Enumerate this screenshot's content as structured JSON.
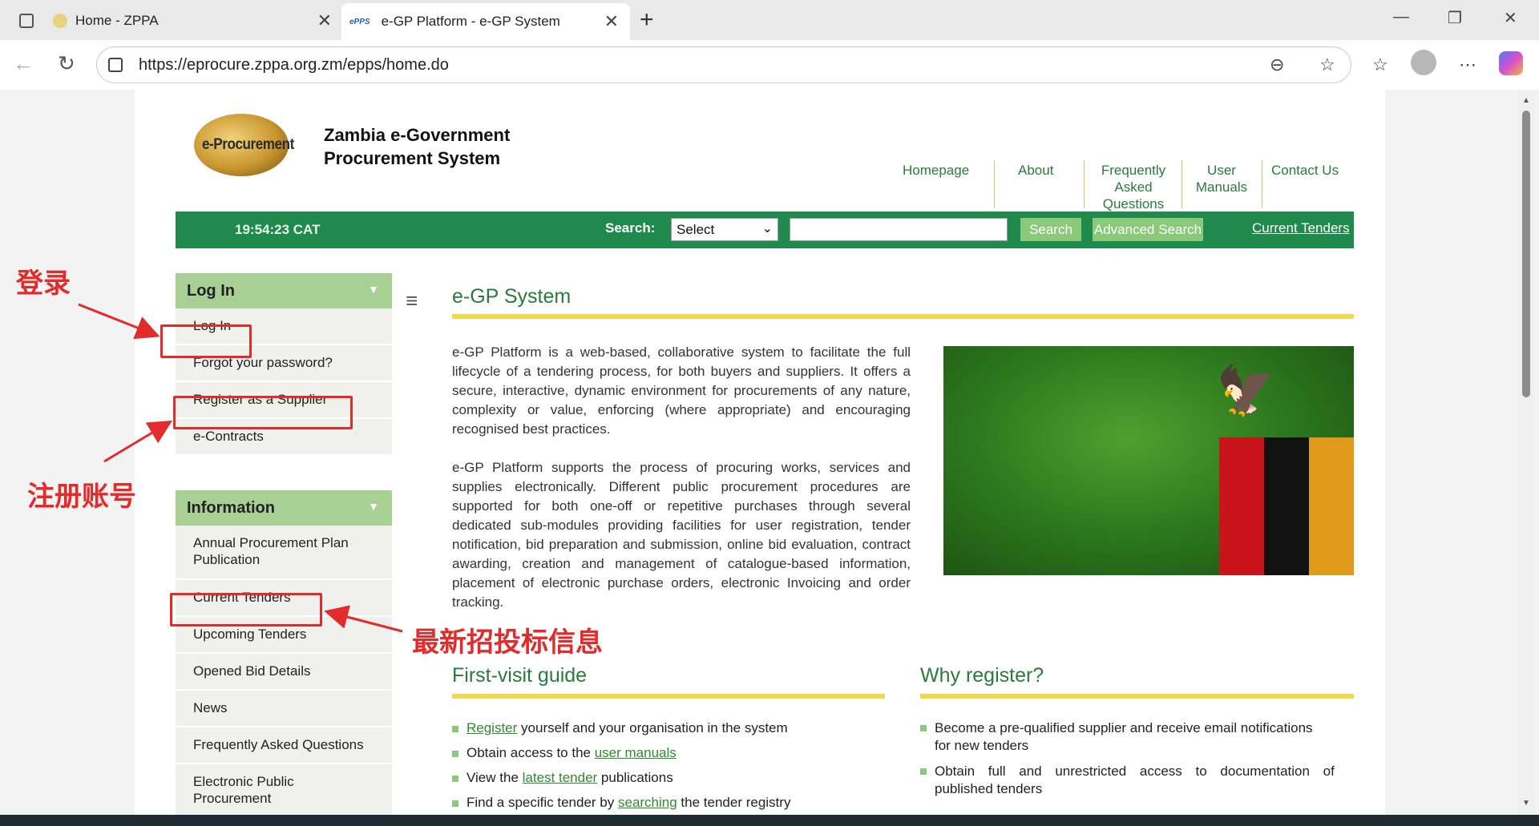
{
  "browser": {
    "tab1_title": "Home - ZPPA",
    "tab2_title": "e-GP Platform - e-GP System",
    "tab2_favicon": "ePPS",
    "url": "https://eprocure.zppa.org.zm/epps/home.do"
  },
  "header": {
    "logo_text": "e-Procurement",
    "brand_line1": "Zambia e-Government",
    "brand_line2": "Procurement System",
    "nav": {
      "homepage": "Homepage",
      "about": "About",
      "faq_1": "Frequently",
      "faq_2": "Asked",
      "faq_3": "Questions",
      "manuals_1": "User",
      "manuals_2": "Manuals",
      "contact": "Contact Us"
    }
  },
  "greenbar": {
    "clock": "19:54:23 CAT",
    "search_label": "Search:",
    "select_value": "Select",
    "search_button": "Search",
    "advanced_button": "Advanced Search",
    "current_tenders": "Current Tenders"
  },
  "sidebar": {
    "login_header": "Log In",
    "login_items": [
      "Log In",
      "Forgot your password?",
      "Register as a Supplier",
      "e-Contracts"
    ],
    "info_header": "Information",
    "info_item_app_1": "Annual Procurement Plan",
    "info_item_app_2": "Publication",
    "info_items": [
      "Current Tenders",
      "Upcoming Tenders",
      "Opened Bid Details",
      "News",
      "Frequently Asked Questions"
    ],
    "info_item_epp_1": "Electronic Public",
    "info_item_epp_2": "Procurement"
  },
  "main": {
    "title": "e-GP System",
    "para1": "e-GP Platform is a web-based, collaborative system to facilitate the full lifecycle of a tendering process, for both buyers and suppliers. It offers a secure, interactive, dynamic environment for procurements of any nature, complexity or value, enforcing (where appropriate) and encouraging recognised best practices.",
    "para2": "e-GP Platform supports the process of procuring works, services and supplies electronically. Different public procurement procedures are supported for both one-off or repetitive purchases through several dedicated sub-modules providing facilities for user registration, tender notification, bid preparation and submission, online bid evaluation, contract awarding, creation and management of catalogue-based information, placement of electronic purchase orders, electronic Invoicing and order tracking.",
    "guide_title": "First-visit guide",
    "guide": {
      "b1_link": "Register",
      "b1_text": " yourself and your organisation in the system",
      "b2_text": "Obtain access to the ",
      "b2_link": "user manuals",
      "b3_text": "View the ",
      "b3_link": "latest tender",
      "b3_tail": " publications",
      "b4_text": "Find a specific tender by ",
      "b4_link": "searching",
      "b4_tail": " the tender registry"
    },
    "why_title": "Why register?",
    "why": {
      "b1_1": "Become a pre-qualified supplier and receive email notifications",
      "b1_2": "for new tenders",
      "b2_1": "Obtain full and unrestricted access to documentation of",
      "b2_2": "published tenders"
    }
  },
  "annotations": {
    "login": "登录",
    "register": "注册账号",
    "tenders": "最新招投标信息"
  },
  "colors": {
    "green_bar": "#1f8a4c",
    "sidebar_header": "#a8cf94",
    "accent_yellow": "#f1d84d",
    "annotation_red": "#e22b2b"
  }
}
